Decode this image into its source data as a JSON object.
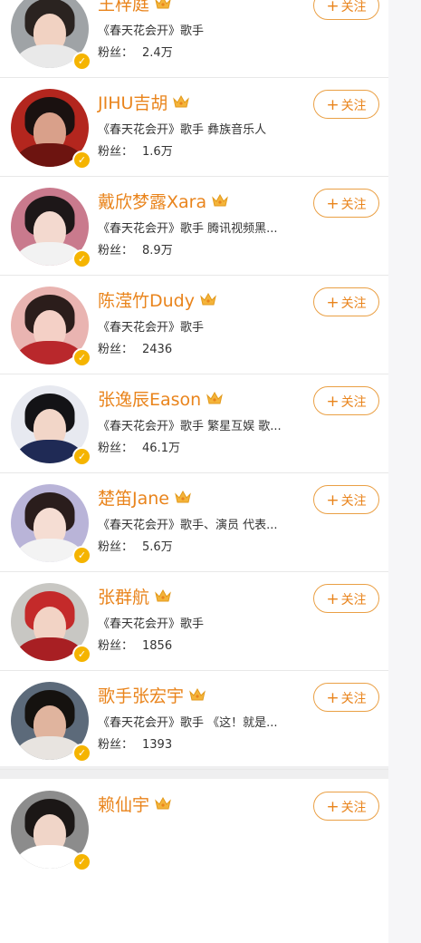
{
  "users": [
    {
      "name": "王梓庭",
      "desc": "《春天花会开》歌手",
      "fans_label": "粉丝：",
      "fans": "2.4万",
      "follow": "关注",
      "plus": "+",
      "verified": "✓",
      "avatar": {
        "bg": "#9fa3a6",
        "hair": "#2a2320",
        "face": "#f1d2c2",
        "body": "#e9e9e9"
      }
    },
    {
      "name": "JIHU吉胡",
      "desc": "《春天花会开》歌手 彝族音乐人",
      "fans_label": "粉丝：",
      "fans": "1.6万",
      "follow": "关注",
      "plus": "+",
      "verified": "✓",
      "avatar": {
        "bg": "#b3261e",
        "hair": "#1a1110",
        "face": "#d9a08a",
        "body": "#6d1410"
      }
    },
    {
      "name": "戴欣梦露Xara",
      "desc": "《春天花会开》歌手 腾讯视频黑...",
      "fans_label": "粉丝：",
      "fans": "8.9万",
      "follow": "关注",
      "plus": "+",
      "verified": "✓",
      "avatar": {
        "bg": "#c97a8d",
        "hair": "#1d1718",
        "face": "#f3d9cf",
        "body": "#f2f2f2"
      }
    },
    {
      "name": "陈滢竹Dudy",
      "desc": "《春天花会开》歌手",
      "fans_label": "粉丝：",
      "fans": "2436",
      "follow": "关注",
      "plus": "+",
      "verified": "✓",
      "avatar": {
        "bg": "#e9b4b1",
        "hair": "#2b1d1b",
        "face": "#f4d0c6",
        "body": "#b9282c"
      }
    },
    {
      "name": "张逸辰Eason",
      "desc": "《春天花会开》歌手 繁星互娱 歌...",
      "fans_label": "粉丝：",
      "fans": "46.1万",
      "follow": "关注",
      "plus": "+",
      "verified": "✓",
      "avatar": {
        "bg": "#e7e9f0",
        "hair": "#131316",
        "face": "#f2d6c8",
        "body": "#1f2a55"
      }
    },
    {
      "name": "楚笛Jane",
      "desc": "《春天花会开》歌手、演员 代表...",
      "fans_label": "粉丝：",
      "fans": "5.6万",
      "follow": "关注",
      "plus": "+",
      "verified": "✓",
      "avatar": {
        "bg": "#b9b4d8",
        "hair": "#2a1d1c",
        "face": "#f5ddd3",
        "body": "#f3f3f3"
      }
    },
    {
      "name": "张群航",
      "desc": "《春天花会开》歌手",
      "fans_label": "粉丝：",
      "fans": "1856",
      "follow": "关注",
      "plus": "+",
      "verified": "✓",
      "avatar": {
        "bg": "#c8c7c3",
        "hair": "#c42a2a",
        "face": "#f2d3c5",
        "body": "#a81f23"
      }
    },
    {
      "name": "歌手张宏宇",
      "desc": "《春天花会开》歌手 《这！就是...",
      "fans_label": "粉丝：",
      "fans": "1393",
      "follow": "关注",
      "plus": "+",
      "verified": "✓",
      "avatar": {
        "bg": "#5c6a7a",
        "hair": "#15120f",
        "face": "#e0b49e",
        "body": "#e8e4e0"
      }
    },
    {
      "name": "赖仙宇",
      "desc": "",
      "fans_label": "",
      "fans": "",
      "follow": "关注",
      "plus": "+",
      "verified": "✓",
      "avatar": {
        "bg": "#8c8c8c",
        "hair": "#1b1716",
        "face": "#f0d5c8",
        "body": "#ffffff"
      }
    }
  ],
  "colors": {
    "accent": "#e9841c",
    "crown": "#f4b43a",
    "verified": "#f5b400"
  }
}
